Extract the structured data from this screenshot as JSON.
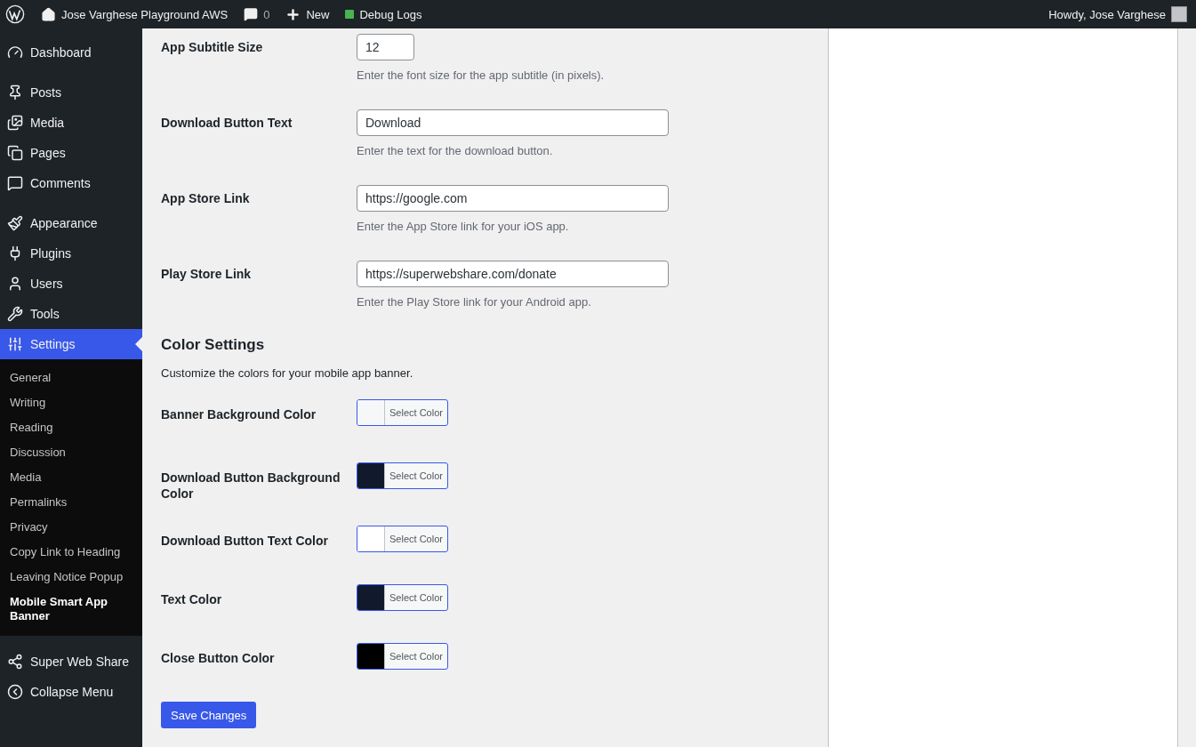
{
  "admin_bar": {
    "site_name": "Jose Varghese Playground AWS",
    "comments_count": "0",
    "new_label": "New",
    "debug_label": "Debug Logs",
    "greeting": "Howdy, Jose Varghese"
  },
  "sidebar": {
    "groups": [
      {
        "items": [
          {
            "label": "Dashboard",
            "selected": false
          }
        ]
      },
      {
        "items": [
          {
            "label": "Posts",
            "selected": false
          },
          {
            "label": "Media",
            "selected": false
          },
          {
            "label": "Pages",
            "selected": false
          },
          {
            "label": "Comments",
            "selected": false
          }
        ]
      },
      {
        "items": [
          {
            "label": "Appearance",
            "selected": false
          },
          {
            "label": "Plugins",
            "selected": false
          },
          {
            "label": "Users",
            "selected": false
          },
          {
            "label": "Tools",
            "selected": false
          },
          {
            "label": "Settings",
            "selected": true,
            "children": [
              {
                "label": "General",
                "selected": false
              },
              {
                "label": "Writing",
                "selected": false
              },
              {
                "label": "Reading",
                "selected": false
              },
              {
                "label": "Discussion",
                "selected": false
              },
              {
                "label": "Media",
                "selected": false
              },
              {
                "label": "Permalinks",
                "selected": false
              },
              {
                "label": "Privacy",
                "selected": false
              },
              {
                "label": "Copy Link to Heading",
                "selected": false
              },
              {
                "label": "Leaving Notice Popup",
                "selected": false
              },
              {
                "label": "Mobile Smart App Banner",
                "selected": true
              }
            ]
          },
          {
            "label": "Super Web Share",
            "selected": false
          },
          {
            "label": "Collapse Menu",
            "selected": false
          }
        ]
      }
    ]
  },
  "fields": [
    {
      "label": "App Subtitle Size",
      "value": "12",
      "kind": "short",
      "description": "Enter the font size for the app subtitle (in pixels)."
    },
    {
      "label": "Download Button Text",
      "value": "Download",
      "kind": "wide",
      "description": "Enter the text for the download button."
    },
    {
      "label": "App Store Link",
      "value": "https://google.com",
      "kind": "wide",
      "description": "Enter the App Store link for your iOS app."
    },
    {
      "label": "Play Store Link",
      "value": "https://superwebshare.com/donate",
      "kind": "wide",
      "description": "Enter the Play Store link for your Android app."
    }
  ],
  "color_settings": {
    "heading": "Color Settings",
    "description": "Customize the colors for your mobile app banner.",
    "colors": [
      {
        "label": "Banner Background Color",
        "color": "#f6f7f9",
        "button": "Select Color"
      },
      {
        "label": "Download Button Background Color",
        "color": "#111a2c",
        "button": "Select Color"
      },
      {
        "label": "Download Button Text Color",
        "color": "#ffffff",
        "button": "Select Color"
      },
      {
        "label": "Text Color",
        "color": "#111a2c",
        "button": "Select Color"
      },
      {
        "label": "Close Button Color",
        "color": "#000000",
        "button": "Select Color"
      }
    ]
  },
  "save_button": "Save Changes"
}
